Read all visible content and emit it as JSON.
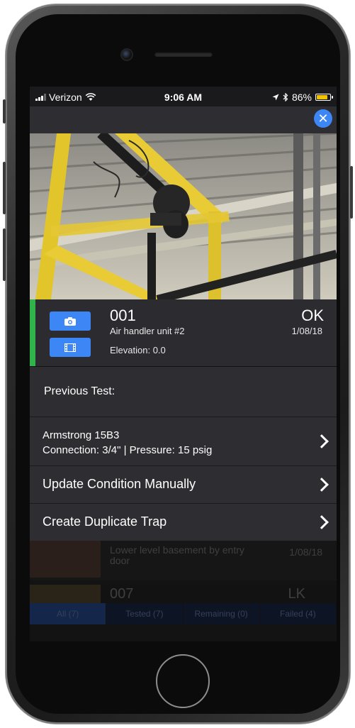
{
  "status_bar": {
    "carrier": "Verizon",
    "time": "9:06 AM",
    "battery": "86%",
    "battery_level": 0.86,
    "icons": [
      "signal-icon",
      "wifi-icon",
      "location-arrow-icon",
      "bluetooth-icon",
      "battery-icon"
    ]
  },
  "modal": {
    "close_icon": "close-icon",
    "trap": {
      "number": "001",
      "description": "Air handler unit #2",
      "elevation": "Elevation: 0.0",
      "status": "OK",
      "date": "1/08/18",
      "status_color": "#2fb34a"
    },
    "media_buttons": [
      "camera-icon",
      "film-icon"
    ],
    "previous_test_label": "Previous Test:",
    "model_row": {
      "line1": "Armstrong 15B3",
      "line2": "Connection: 3/4\" | Pressure: 15 psig"
    },
    "update_condition_label": "Update Condition Manually",
    "duplicate_trap_label": "Create Duplicate Trap"
  },
  "background_list": {
    "items": [
      {
        "description": "Lower level basement by entry door",
        "date": "1/08/18"
      },
      {
        "number": "007",
        "status": "LK"
      }
    ],
    "filters": [
      "All (7)",
      "Tested (7)",
      "Remaining (0)",
      "Failed (4)"
    ]
  },
  "colors": {
    "accent": "#3d86f5",
    "ok_green": "#2fb34a",
    "panel": "#2e2e32"
  }
}
